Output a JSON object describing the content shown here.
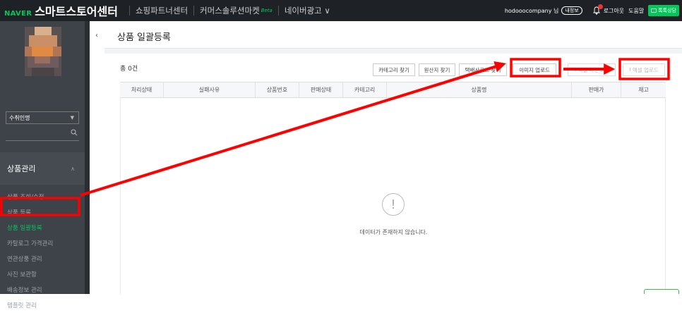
{
  "header": {
    "naver_logo": "NAVER",
    "brand_title": "스마트스토어센터",
    "nav": [
      {
        "label": "쇼핑파트너센터"
      },
      {
        "label": "커머스솔루션마켓",
        "badge": "Beta"
      },
      {
        "label": "네이버광고 ∨"
      }
    ],
    "user": "hodooocompany 님",
    "my_info": "내정보",
    "logout": "로그아웃",
    "help": "도움말",
    "talk": "톡톡상담",
    "accent_color": "#03c75a"
  },
  "sidebar": {
    "store_select": "수취인명",
    "section_title": "상품관리",
    "items": [
      {
        "label": "상품 조회/수정"
      },
      {
        "label": "상품 등록"
      },
      {
        "label": "상품 일괄등록",
        "active": true
      },
      {
        "label": "카탈로그 가격관리"
      },
      {
        "label": "연관상품 관리"
      },
      {
        "label": "사진 보관함"
      },
      {
        "label": "배송정보 관리"
      },
      {
        "label": "템플릿 관리"
      }
    ]
  },
  "page": {
    "title": "상품 일괄등록",
    "count": "총 0건",
    "buttons": {
      "category": "카테고리 찾기",
      "origin": "원산지 찾기",
      "courier": "택배사코드 찾기",
      "image_upload": "이미지 업로드",
      "excel_download": "엑셀 다운로드",
      "excel_upload": "엑셀 업로드"
    },
    "columns": [
      "처리상태",
      "실패사유",
      "상품번호",
      "판매상태",
      "카테고리",
      "상품명",
      "판매가",
      "재고"
    ],
    "empty_message": "데이터가 존재하지 않습니다."
  },
  "annotation_color": "#ff0000"
}
